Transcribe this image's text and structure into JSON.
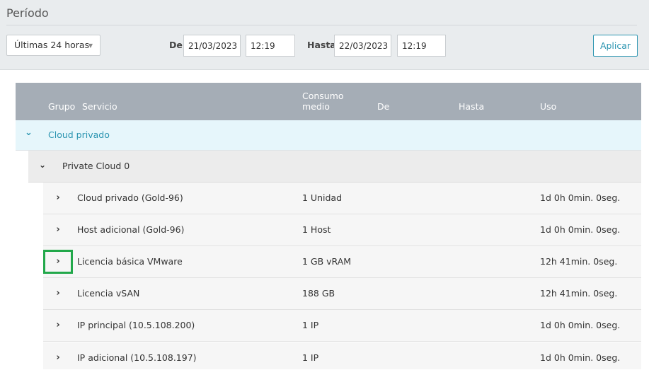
{
  "period": {
    "title": "Período",
    "range_value": "Últimas 24 horas",
    "from_label": "De",
    "from_date": "21/03/2023",
    "from_time": "12:19",
    "to_label": "Hasta",
    "to_date": "22/03/2023",
    "to_time": "12:19",
    "apply_label": "Aplicar"
  },
  "table": {
    "headers": {
      "grupo": "Grupo",
      "servicio": "Servicio",
      "consumo_line1": "Consumo",
      "consumo_line2": "medio",
      "de": "De",
      "hasta": "Hasta",
      "uso": "Uso"
    },
    "group": {
      "label": "Cloud privado",
      "icon": "chevron-down-icon"
    },
    "subgroup": {
      "label": "Private Cloud 0",
      "icon": "chevron-down-icon"
    },
    "rows": [
      {
        "name": "Cloud privado (Gold-96)",
        "consumo": "1 Unidad",
        "uso": "1d 0h 0min. 0seg."
      },
      {
        "name": "Host adicional (Gold-96)",
        "consumo": "1 Host",
        "uso": "1d 0h 0min. 0seg."
      },
      {
        "name": "Licencia básica VMware",
        "consumo": "1 GB vRAM",
        "uso": "12h 41min. 0seg."
      },
      {
        "name": "Licencia vSAN",
        "consumo": "188 GB",
        "uso": "12h 41min. 0seg."
      },
      {
        "name": "IP principal (10.5.108.200)",
        "consumo": "1 IP",
        "uso": "1d 0h 0min. 0seg."
      },
      {
        "name": "IP adicional (10.5.108.197)",
        "consumo": "1 IP",
        "uso": "1d 0h 0min. 0seg."
      }
    ]
  },
  "colors": {
    "accent": "#2a94b0",
    "header_bg": "#a5adb6",
    "highlight": "#22a84a"
  }
}
